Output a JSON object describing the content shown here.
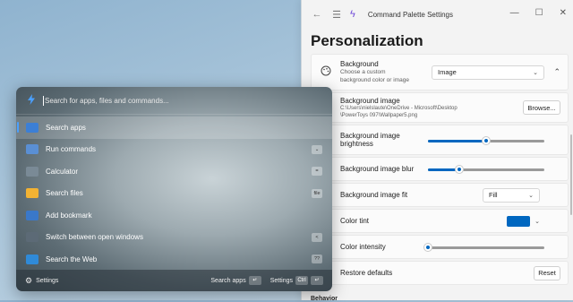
{
  "window": {
    "title": "Command Palette Settings",
    "back_icon": "←",
    "menu_icon": "☰",
    "app_glyph": "ϟ",
    "min_icon": "—",
    "max_icon": "☐",
    "close_icon": "✕"
  },
  "page_title": "Personalization",
  "settings": {
    "background": {
      "label": "Background",
      "desc_line1": "Choose a custom",
      "desc_line2": "background color or image",
      "value": "Image",
      "chevron": "⌄",
      "collapse_icon": "⌃"
    },
    "background_image": {
      "label": "Background image",
      "path_line1": "C:\\Users\\nielslaute\\OneDrive - Microsoft\\Desktop",
      "path_line2": "\\PowerToys 097\\Wallpaper5.png",
      "browse_label": "Browse..."
    },
    "brightness": {
      "label_line1": "Background image",
      "label_line2": "brightness",
      "value": 0.5
    },
    "blur": {
      "label": "Background image blur",
      "value": 0.27
    },
    "fit": {
      "label": "Background image fit",
      "value": "Fill",
      "chevron": "⌄"
    },
    "tint": {
      "label": "Color tint",
      "color": "#0067c0",
      "chevron": "⌄"
    },
    "intensity": {
      "label": "Color intensity",
      "value": 0.0
    },
    "restore": {
      "label": "Restore defaults",
      "button_label": "Reset"
    },
    "next_section": "Behavior"
  },
  "palette": {
    "placeholder": "Search for apps, files and commands...",
    "items": [
      {
        "label": "Search apps",
        "icon_color": "#3c7fd6",
        "key": ""
      },
      {
        "label": "Run commands",
        "icon_color": "#5a8fd4",
        "key": "⌄"
      },
      {
        "label": "Calculator",
        "icon_color": "#7a8a96",
        "key": "="
      },
      {
        "label": "Search files",
        "icon_color": "#f2b233",
        "key": "file"
      },
      {
        "label": "Add bookmark",
        "icon_color": "#3a78c9",
        "key": ""
      },
      {
        "label": "Switch between open windows",
        "icon_color": "#5c6a76",
        "key": "<"
      },
      {
        "label": "Search the Web",
        "icon_color": "#2f8ad8",
        "key": "??"
      }
    ],
    "footer": {
      "settings_label": "Settings",
      "search_apps_label": "Search apps",
      "enter_key": "↵",
      "settings_right_label": "Settings",
      "ctrl_key": "Ctrl",
      "enter_key2": "↵"
    }
  }
}
